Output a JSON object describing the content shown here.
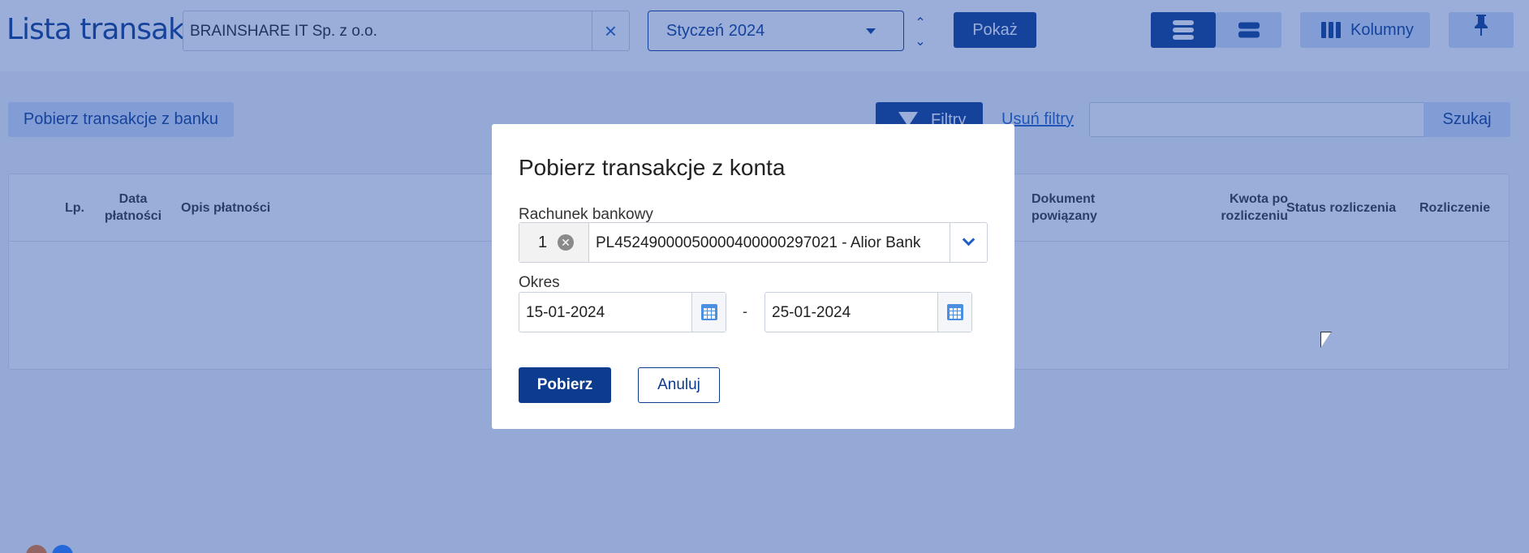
{
  "header": {
    "title": "Lista transakcji",
    "company_value": "BRAINSHARE IT Sp. z o.o.",
    "month_value": "Styczeń 2024",
    "show_label": "Pokaż",
    "columns_label": "Kolumny"
  },
  "toolbar": {
    "fetch_bank_label": "Pobierz transakcje z banku",
    "filters_label": "Filtry",
    "clear_filters_label": "Usuń filtry",
    "search_value": "",
    "search_label": "Szukaj"
  },
  "table": {
    "columns": {
      "lp": "Lp.",
      "date_1": "Data",
      "date_2": "płatności",
      "desc": "Opis płatności",
      "doc_1": "Dokument",
      "doc_2": "powiązany",
      "amount_1": "Kwota po",
      "amount_2": "rozliczeniu",
      "status": "Status rozliczenia",
      "settlement": "Rozliczenie"
    }
  },
  "modal": {
    "title": "Pobierz transakcje z konta",
    "account_label": "Rachunek bankowy",
    "account_count": "1",
    "account_value": "PL45249000050000400000297021 - Alior Bank",
    "period_label": "Okres",
    "date_from": "15-01-2024",
    "date_separator": "-",
    "date_to": "25-01-2024",
    "fetch_label": "Pobierz",
    "cancel_label": "Anuluj"
  },
  "icons": {
    "clear": "×",
    "stepper_up": "⌃",
    "stepper_down": "⌄",
    "pin": "📌",
    "remove": "✕"
  },
  "colors": {
    "primary": "#0d3b8e",
    "accent": "#1f5fc4",
    "secondary_button": "#d3e1f8"
  }
}
